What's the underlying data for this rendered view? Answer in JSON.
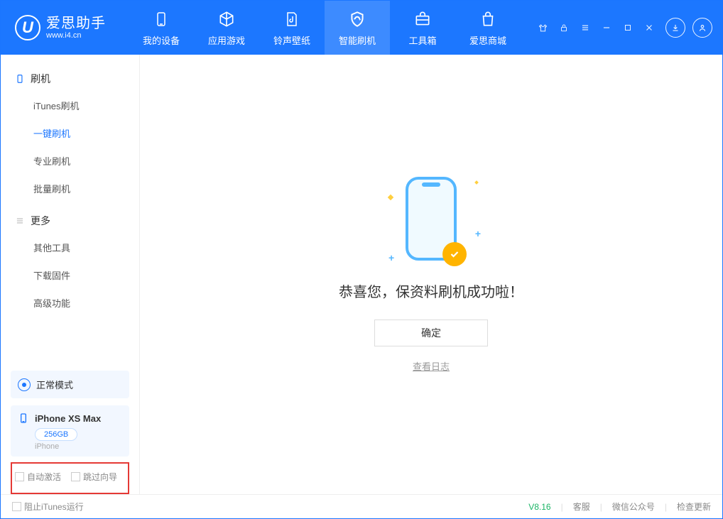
{
  "branding": {
    "title": "爱思助手",
    "url": "www.i4.cn",
    "logo_letter": "U"
  },
  "topTabs": {
    "items": [
      {
        "label": "我的设备"
      },
      {
        "label": "应用游戏"
      },
      {
        "label": "铃声壁纸"
      },
      {
        "label": "智能刷机"
      },
      {
        "label": "工具箱"
      },
      {
        "label": "爱思商城"
      }
    ],
    "activeIndex": 3
  },
  "sidebar": {
    "group1": {
      "title": "刷机",
      "items": [
        {
          "label": "iTunes刷机"
        },
        {
          "label": "一键刷机"
        },
        {
          "label": "专业刷机"
        },
        {
          "label": "批量刷机"
        }
      ],
      "activeIndex": 1
    },
    "group2": {
      "title": "更多",
      "items": [
        {
          "label": "其他工具"
        },
        {
          "label": "下载固件"
        },
        {
          "label": "高级功能"
        }
      ]
    },
    "mode": {
      "label": "正常模式"
    },
    "device": {
      "name": "iPhone XS Max",
      "storage": "256GB",
      "subtitle": "iPhone"
    },
    "checkboxes": {
      "auto_activate": "自动激活",
      "skip_guide": "跳过向导"
    }
  },
  "content": {
    "success_message": "恭喜您，保资料刷机成功啦！",
    "ok_button": "确定",
    "view_log": "查看日志"
  },
  "statusbar": {
    "block_itunes": "阻止iTunes运行",
    "version": "V8.16",
    "support": "客服",
    "wechat": "微信公众号",
    "check_update": "检查更新"
  }
}
